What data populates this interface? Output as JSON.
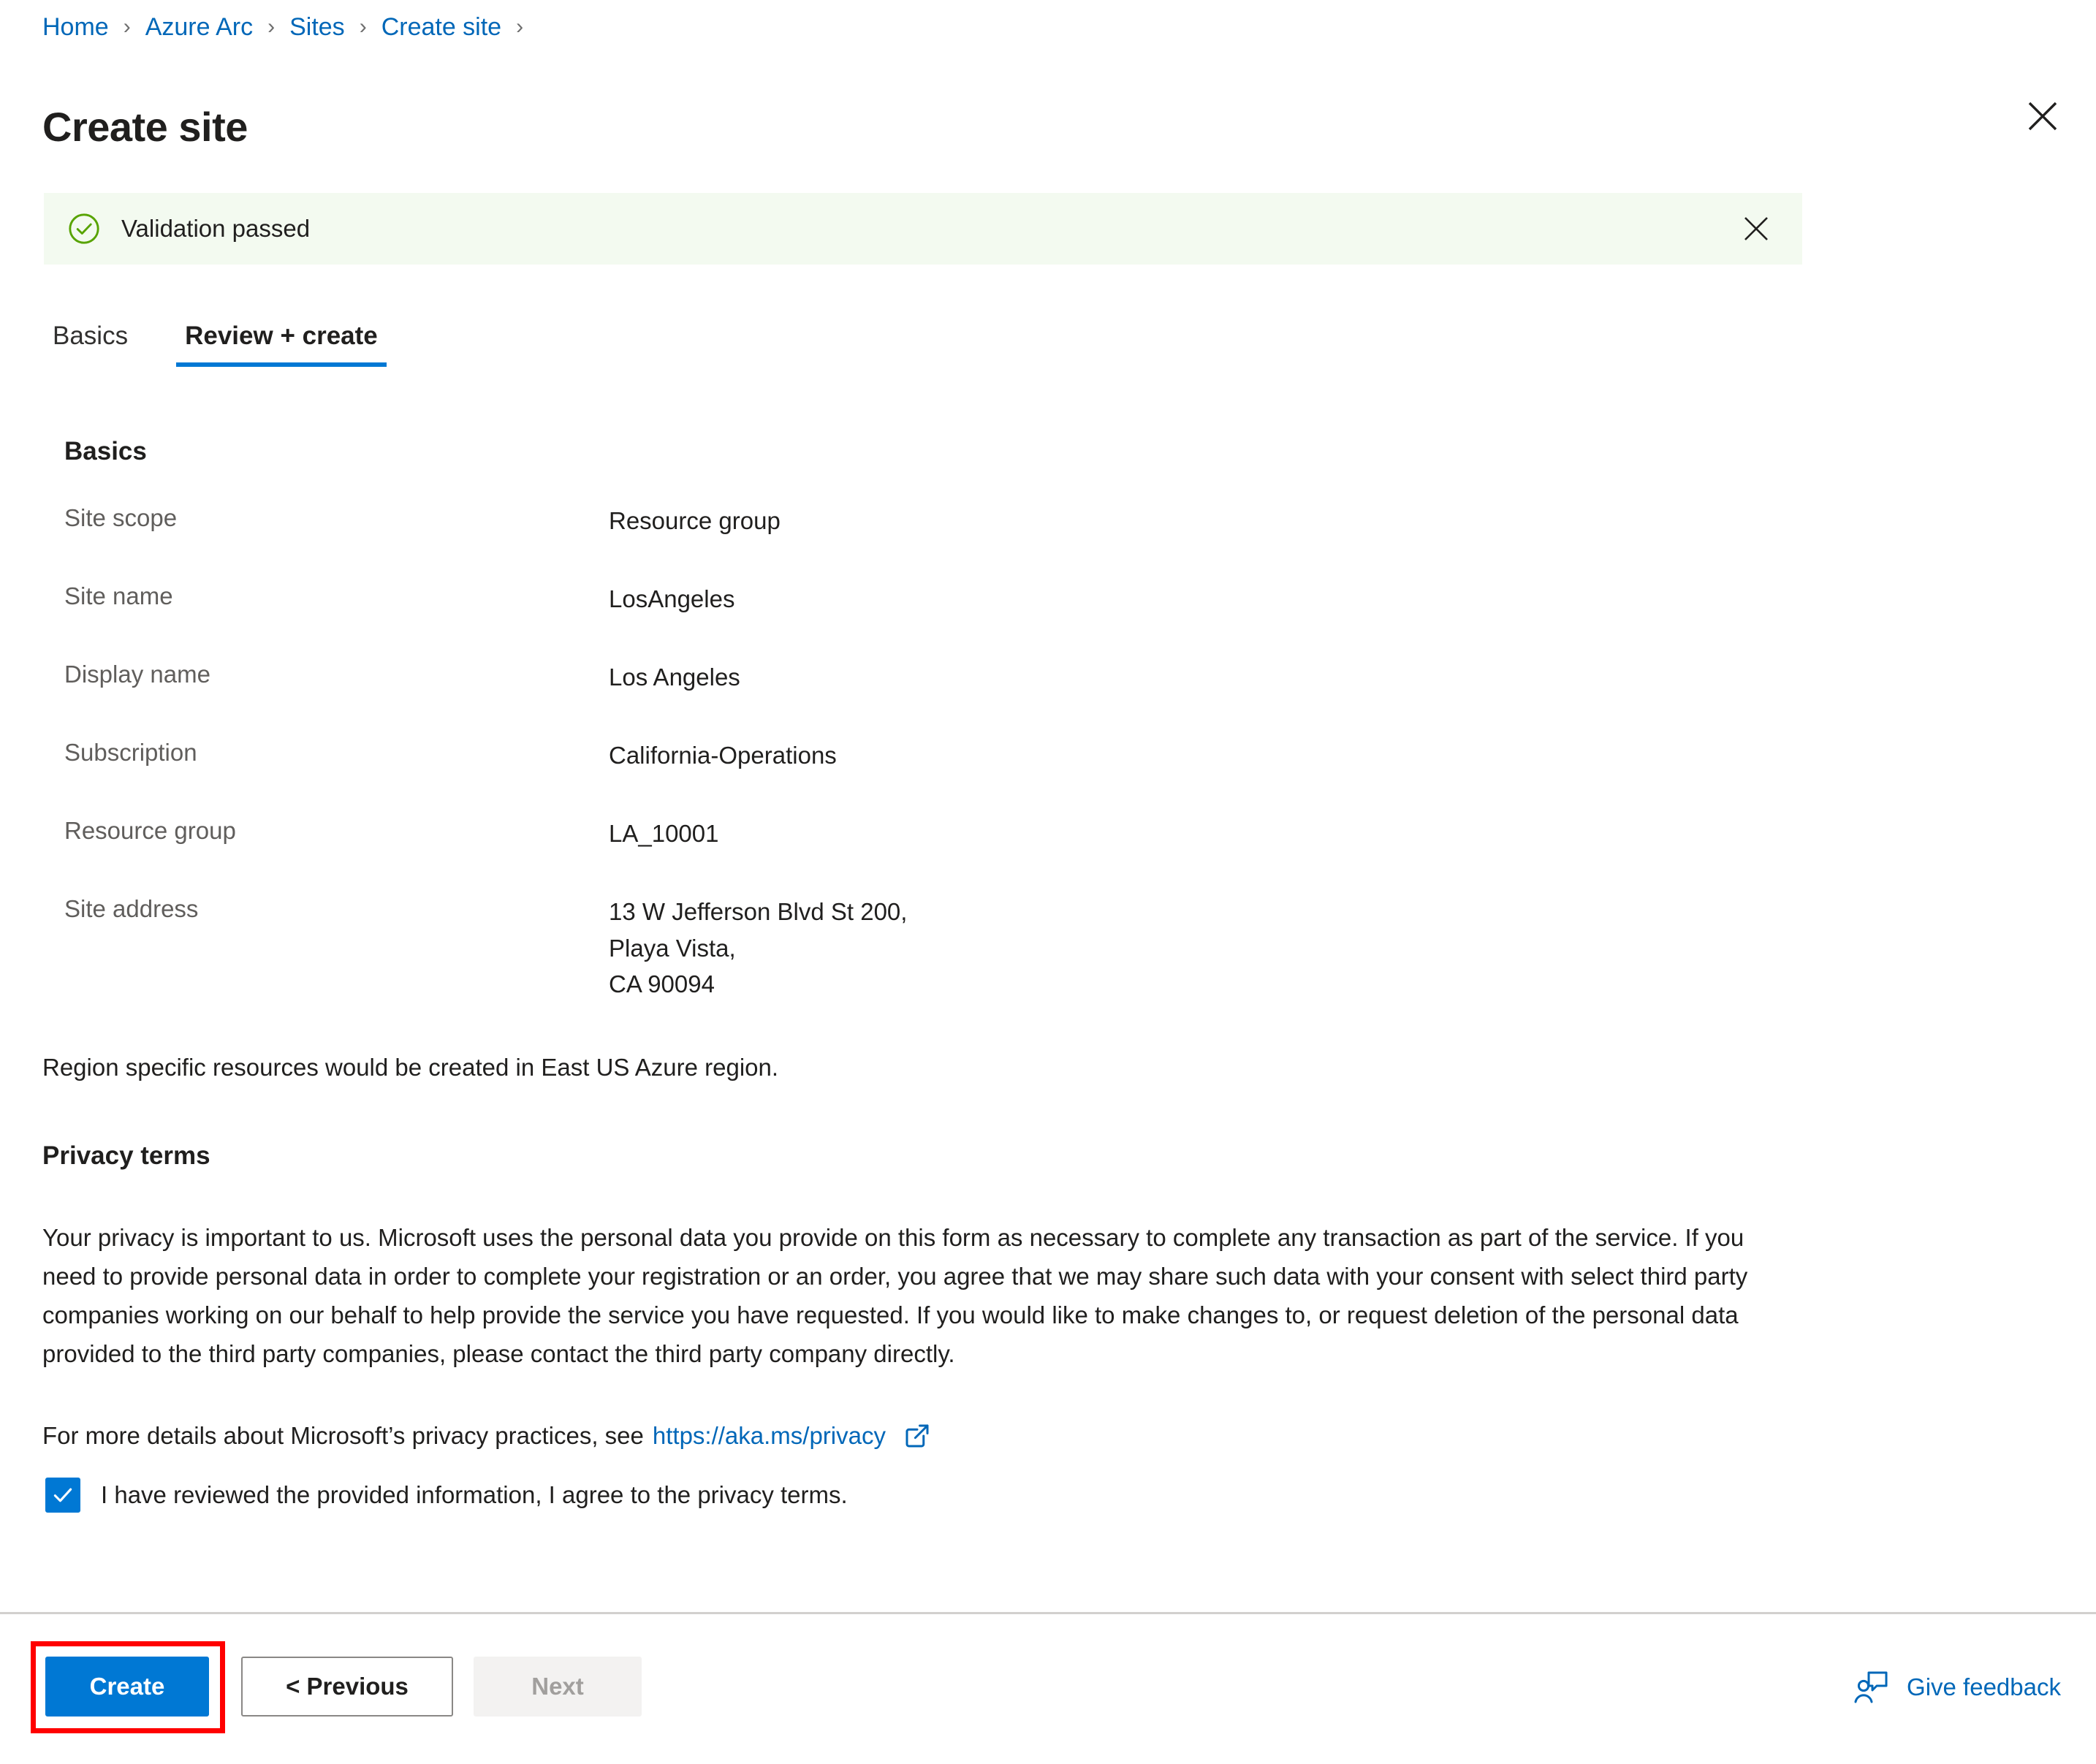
{
  "breadcrumb": {
    "items": [
      {
        "label": "Home"
      },
      {
        "label": "Azure Arc"
      },
      {
        "label": "Sites"
      },
      {
        "label": "Create site"
      }
    ],
    "separator": "›"
  },
  "header": {
    "title": "Create site",
    "close_icon": "close-icon"
  },
  "banner": {
    "icon": "check-circle-icon",
    "message": "Validation passed",
    "close_icon": "close-icon",
    "background": "#f3faf0",
    "icon_color": "#57a300"
  },
  "tabs": [
    {
      "label": "Basics",
      "active": false
    },
    {
      "label": "Review + create",
      "active": true
    }
  ],
  "basics": {
    "section_title": "Basics",
    "rows": [
      {
        "key": "Site scope",
        "value": "Resource group"
      },
      {
        "key": "Site name",
        "value": "LosAngeles"
      },
      {
        "key": "Display name",
        "value": "Los Angeles"
      },
      {
        "key": "Subscription",
        "value": "California-Operations"
      },
      {
        "key": "Resource group",
        "value": "LA_10001"
      },
      {
        "key": "Site address",
        "value": "13 W Jefferson Blvd St 200,\nPlaya Vista,\nCA 90094"
      }
    ]
  },
  "region_note": "Region specific resources would be created in East US Azure region.",
  "privacy": {
    "title": "Privacy terms",
    "body": "Your privacy is important to us. Microsoft uses the personal data you provide on this form as necessary to complete any transaction as part of the service. If you need to provide personal data in order to complete your registration or an order, you agree that we may share such data with your consent with select third party companies working on our behalf to help provide the service you have requested. If you would like to make changes to, or request deletion of the personal data provided to the third party companies, please contact the third party company directly.",
    "more_text": "For more details about Microsoft’s privacy practices, see",
    "link_text": "https://aka.ms/privacy",
    "link_icon": "external-link-icon",
    "agree_label": "I have reviewed the provided information, I agree to the privacy terms.",
    "agree_checked": true
  },
  "footer": {
    "create_label": "Create",
    "previous_label": "< Previous",
    "next_label": "Next",
    "next_disabled": true,
    "feedback_label": "Give feedback",
    "feedback_icon": "person-feedback-icon"
  },
  "colors": {
    "link": "#0067b8",
    "accent": "#0078d4",
    "highlight": "#ff0000",
    "banner_bg": "#f3faf0"
  }
}
